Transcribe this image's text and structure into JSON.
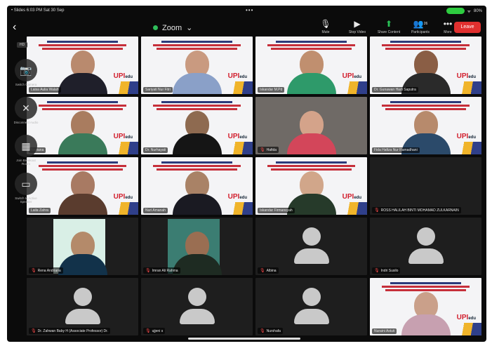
{
  "status": {
    "time_date": "• Slides 6:03 PM Sat 30 Sep",
    "dots": "•••",
    "battery": "80%"
  },
  "toolbar": {
    "back": "‹",
    "title": "Zoom",
    "buttons": [
      {
        "label": "Mute",
        "icon": "microphone-icon"
      },
      {
        "label": "Stop Video",
        "icon": "video-camera-icon"
      },
      {
        "label": "Share Content",
        "icon": "share-screen-icon"
      },
      {
        "label": "Participants",
        "icon": "participants-icon",
        "count": "26"
      },
      {
        "label": "More",
        "icon": "more-icon"
      }
    ],
    "leave": "Leave"
  },
  "side": {
    "badge": "HD",
    "buttons": [
      {
        "label": "Switch Camera",
        "icon": "camera-flip-icon"
      },
      {
        "label": "Disconnect Audio",
        "icon": "audio-off-icon"
      },
      {
        "label": "Join Breakout Room",
        "icon": "breakout-room-icon"
      },
      {
        "label": "Switch to Active Speaker",
        "icon": "speaker-view-icon"
      }
    ]
  },
  "tiles": [
    {
      "name": "Laisa Aulia Walah",
      "muted": false,
      "kind": "slide",
      "skin": "#b98a6e",
      "cloth": "#1f1f2a"
    },
    {
      "name": "Sariyati Nur Fitri",
      "muted": false,
      "kind": "slide",
      "skin": "#c99a80",
      "cloth": "#8aa0c8"
    },
    {
      "name": "Iskandar M.Pd",
      "muted": false,
      "kind": "slide",
      "skin": "#c08f6f",
      "cloth": "#2e9a6a"
    },
    {
      "name": "Dr. Gunawan Hadi Saputra",
      "muted": false,
      "kind": "slide",
      "skin": "#8a5e45",
      "cloth": "#2a2a2a"
    },
    {
      "name": "Noviana",
      "muted": false,
      "kind": "slide",
      "skin": "#a97c5f",
      "cloth": "#3a7a5a"
    },
    {
      "name": "Dr. Nurhayati",
      "muted": false,
      "kind": "slide",
      "skin": "#8e6a50",
      "cloth": "#151515"
    },
    {
      "name": "Hafida",
      "muted": true,
      "kind": "room",
      "skin": "#d4a38a",
      "cloth": "#d3465a"
    },
    {
      "name": "Fida Hafiza Nur Ramadhani",
      "muted": false,
      "kind": "slide",
      "skin": "#b78a6c",
      "cloth": "#2b4a6a"
    },
    {
      "name": "Laila Zahra",
      "muted": false,
      "kind": "slide",
      "skin": "#a87a63",
      "cloth": "#5a3c2e"
    },
    {
      "name": "Nuri Amanah",
      "muted": false,
      "kind": "slide",
      "skin": "#a98266",
      "cloth": "#1a1a22"
    },
    {
      "name": "Iskandar Firmansyah",
      "muted": false,
      "kind": "slide",
      "skin": "#d1a68a",
      "cloth": "#263a2a"
    },
    {
      "name": "ROSS HALILAH BINTI MOHAMAD ZULKARNAIN",
      "muted": true,
      "kind": "blank"
    },
    {
      "name": "Rena Andriana",
      "muted": true,
      "kind": "photo",
      "skin": "#b48a6a",
      "cloth": "#12324a"
    },
    {
      "name": "Imran Ali Rahma",
      "muted": true,
      "kind": "photo-dark",
      "skin": "#9a6e52",
      "cloth": "#1e2b22"
    },
    {
      "name": "Albina",
      "muted": true,
      "kind": "avatar"
    },
    {
      "name": "Indri Susilo",
      "muted": true,
      "kind": "avatar"
    },
    {
      "name": "Dr. Zahwan Baby H (Associate Professor) Dr.",
      "muted": true,
      "kind": "avatar"
    },
    {
      "name": "ujjeni s",
      "muted": true,
      "kind": "avatar"
    },
    {
      "name": "Nurshafa",
      "muted": true,
      "kind": "avatar"
    },
    {
      "name": "Nuraini Astuti",
      "muted": false,
      "kind": "slide",
      "skin": "#caa08a",
      "cloth": "#c7a0b0"
    }
  ],
  "slide_logo": {
    "a": "UPI",
    "b": "edu"
  },
  "colors": {
    "leave": "#e0302f",
    "accent_green": "#29c257",
    "muted": "#ff4b4b"
  }
}
